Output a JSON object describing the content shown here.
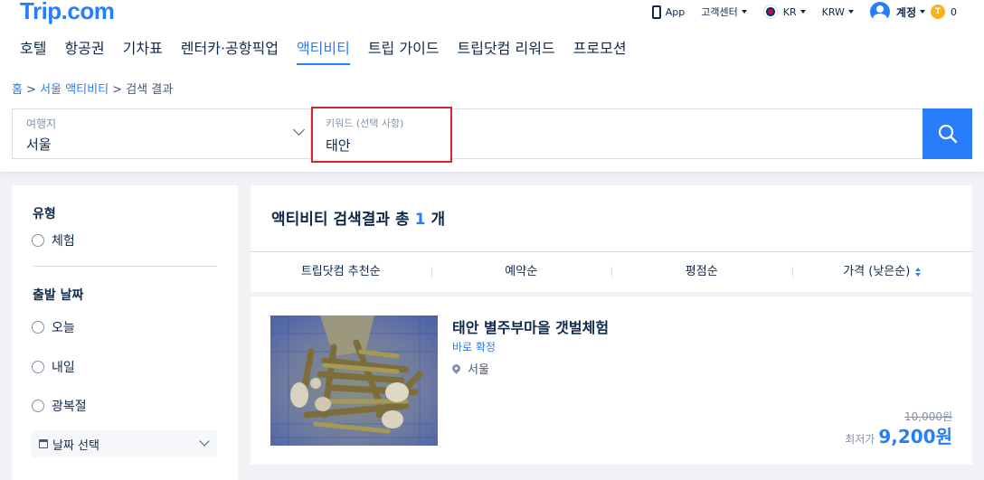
{
  "header": {
    "logo": "Trip.com",
    "topbar": {
      "app": "App",
      "support": "고객센터",
      "region": "KR",
      "currency": "KRW",
      "account": "계정",
      "coins": "0",
      "coin_badge": "T"
    },
    "nav": [
      {
        "label": "호텔",
        "active": false
      },
      {
        "label": "항공권",
        "active": false
      },
      {
        "label": "기차표",
        "active": false
      },
      {
        "label": "렌터카·공항픽업",
        "active": false
      },
      {
        "label": "액티비티",
        "active": true
      },
      {
        "label": "트립 가이드",
        "active": false
      },
      {
        "label": "트립닷컴 리워드",
        "active": false
      },
      {
        "label": "프로모션",
        "active": false
      }
    ]
  },
  "breadcrumb": {
    "home": "홈",
    "sep": " > ",
    "seoul": "서울 액티비티",
    "current": "검색 결과"
  },
  "search": {
    "dest_label": "여행지",
    "dest_value": "서울",
    "keyword_label": "키워드 (선택 사항)",
    "keyword_value": "태안"
  },
  "sidebar": {
    "type_title": "유형",
    "type_options": [
      "체험"
    ],
    "date_title": "출발 날짜",
    "date_options": [
      "오늘",
      "내일",
      "광복절"
    ],
    "date_select": "날짜 선택"
  },
  "results": {
    "title_prefix": "액티비티 검색결과 총",
    "count": "1",
    "title_suffix": "개",
    "sort": [
      "트립닷컴 추천순",
      "예약순",
      "평점순",
      "가격 (낮은순)"
    ]
  },
  "product": {
    "title": "태안 별주부마을 갯벌체험",
    "confirm": "바로 확정",
    "location": "서울",
    "original_price": "10,000원",
    "price_label": "최저가",
    "price": "9,200원"
  },
  "colors": {
    "brand": "#287dfa",
    "highlight_border": "#d9262c",
    "text": "#0f294d"
  }
}
